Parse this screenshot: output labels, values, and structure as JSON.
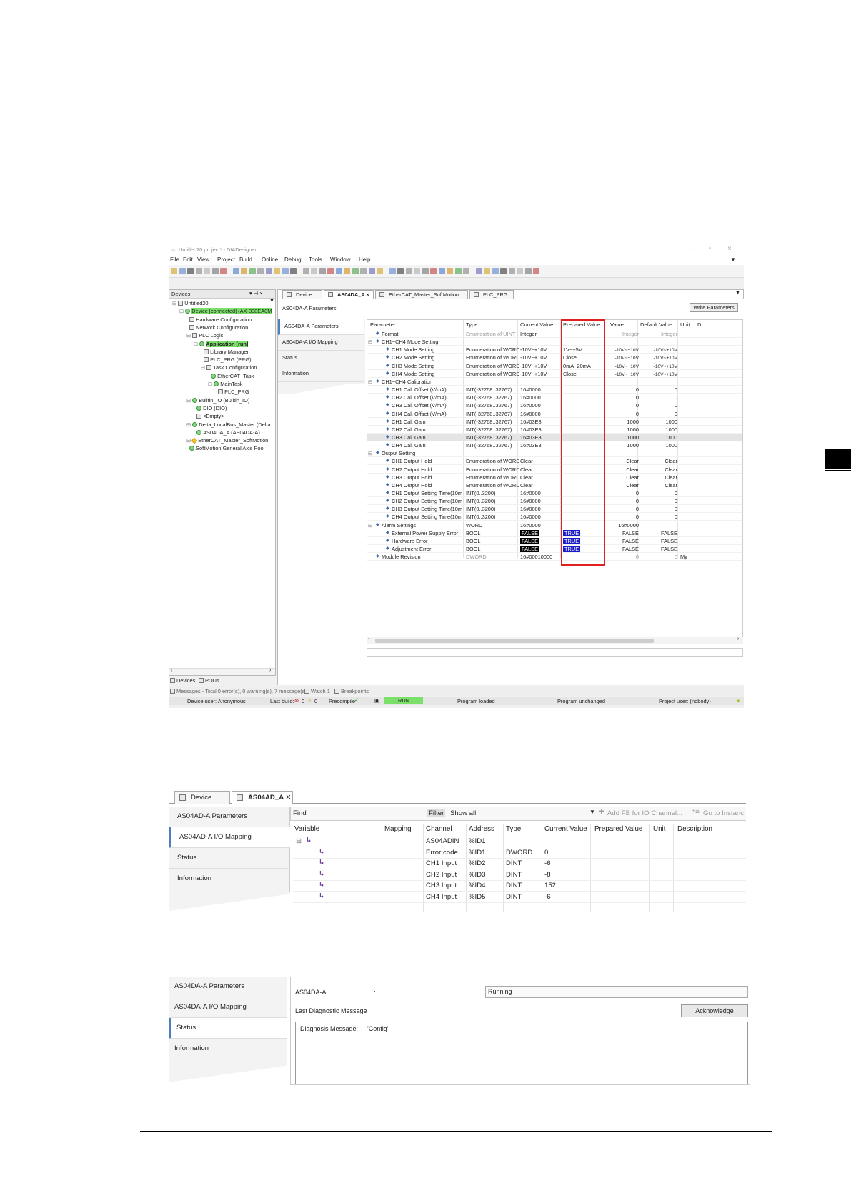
{
  "window": {
    "title": "Untitled20.project* - DIADesigner",
    "menu": [
      "File",
      "Edit",
      "View",
      "Project",
      "Build",
      "Online",
      "Debug",
      "Tools",
      "Window",
      "Help"
    ],
    "devices_panel": {
      "title": "Devices",
      "items": [
        {
          "label": "Untitled20",
          "indent": 0
        },
        {
          "label": "Device [connected] (AX-308EA0M",
          "indent": 1,
          "highlight": true
        },
        {
          "label": "Hardware Configuration",
          "indent": 2
        },
        {
          "label": "Network Configuration",
          "indent": 2
        },
        {
          "label": "PLC Logic",
          "indent": 2
        },
        {
          "label": "Application [run]",
          "indent": 3,
          "highlight": true,
          "bold": true
        },
        {
          "label": "Library Manager",
          "indent": 4
        },
        {
          "label": "PLC_PRG (PRG)",
          "indent": 4
        },
        {
          "label": "Task Configuration",
          "indent": 4
        },
        {
          "label": "EtherCAT_Task",
          "indent": 5
        },
        {
          "label": "MainTask",
          "indent": 5
        },
        {
          "label": "PLC_PRG",
          "indent": 6
        },
        {
          "label": "Builtin_IO (Builtin_IO)",
          "indent": 2
        },
        {
          "label": "DIO (DIO)",
          "indent": 3
        },
        {
          "label": "<Empty>",
          "indent": 3
        },
        {
          "label": "Delta_LocalBus_Master (Delta",
          "indent": 2
        },
        {
          "label": "AS04DA_A (AS04DA-A)",
          "indent": 3
        },
        {
          "label": "EtherCAT_Master_SoftMotion",
          "indent": 2
        },
        {
          "label": "SoftMotion General Axis Pool",
          "indent": 2
        }
      ],
      "bottom_tabs": [
        "Devices",
        "POUs"
      ]
    },
    "tabs": [
      "Device",
      "AS04DA_A",
      "EtherCAT_Master_SoftMotion",
      "PLC_PRG"
    ],
    "nav": [
      "AS04DA-A Parameters",
      "AS04DA-A I/O Mapping",
      "Status",
      "Information"
    ],
    "header_label": "AS04DA-A Parameters",
    "write_button": "Write Parameters",
    "columns": [
      "Parameter",
      "Type",
      "Current Value",
      "Prepared Value",
      "Value",
      "Default Value",
      "Unit",
      "D"
    ],
    "rows": [
      {
        "lvl": 1,
        "p": "Format",
        "t": "Enumeration of UINT",
        "cv": "Integer",
        "pv": "",
        "v": "Integer",
        "dv": "Integer",
        "u": "",
        "gray": true
      },
      {
        "lvl": 1,
        "p": "CH1~CH4 Mode Setting",
        "group": true
      },
      {
        "lvl": 2,
        "p": "CH1 Mode Setting",
        "t": "Enumeration of WORD",
        "cv": "-10V~+10V",
        "pv": "1V~+5V",
        "v": "-10V~+10V",
        "dv": "-10V~+10V"
      },
      {
        "lvl": 2,
        "p": "CH2 Mode Setting",
        "t": "Enumeration of WORD",
        "cv": "-10V~+10V",
        "pv": "Close",
        "v": "-10V~+10V",
        "dv": "-10V~+10V"
      },
      {
        "lvl": 2,
        "p": "CH3 Mode Setting",
        "t": "Enumeration of WORD",
        "cv": "-10V~+10V",
        "pv": "0mA~20mA",
        "v": "-10V~+10V",
        "dv": "-10V~+10V"
      },
      {
        "lvl": 2,
        "p": "CH4 Mode Setting",
        "t": "Enumeration of WORD",
        "cv": "-10V~+10V",
        "pv": "Close",
        "v": "-10V~+10V",
        "dv": "-10V~+10V"
      },
      {
        "lvl": 1,
        "p": "CH1~CH4 Calibration",
        "group": true
      },
      {
        "lvl": 2,
        "p": "CH1 Cal. Offset (V/mA)",
        "t": "INT(-32768..32767)",
        "cv": "16#0000",
        "pv": "",
        "v": "0",
        "dv": "0"
      },
      {
        "lvl": 2,
        "p": "CH2 Cal. Offset (V/mA)",
        "t": "INT(-32768..32767)",
        "cv": "16#0000",
        "pv": "",
        "v": "0",
        "dv": "0"
      },
      {
        "lvl": 2,
        "p": "CH3 Cal. Offset (V/mA)",
        "t": "INT(-32768..32767)",
        "cv": "16#0000",
        "pv": "",
        "v": "0",
        "dv": "0"
      },
      {
        "lvl": 2,
        "p": "CH4 Cal. Offset (V/mA)",
        "t": "INT(-32768..32767)",
        "cv": "16#0000",
        "pv": "",
        "v": "0",
        "dv": "0"
      },
      {
        "lvl": 2,
        "p": "CH1 Cal. Gain",
        "t": "INT(-32768..32767)",
        "cv": "16#03E8",
        "pv": "",
        "v": "1000",
        "dv": "1000"
      },
      {
        "lvl": 2,
        "p": "CH2 Cal. Gain",
        "t": "INT(-32768..32767)",
        "cv": "16#03E8",
        "pv": "",
        "v": "1000",
        "dv": "1000"
      },
      {
        "lvl": 2,
        "p": "CH3 Cal. Gain",
        "t": "INT(-32768..32767)",
        "cv": "16#03E8",
        "pv": "",
        "v": "1000",
        "dv": "1000",
        "sel": true
      },
      {
        "lvl": 2,
        "p": "CH4 Cal. Gain",
        "t": "INT(-32768..32767)",
        "cv": "16#03E8",
        "pv": "",
        "v": "1000",
        "dv": "1000"
      },
      {
        "lvl": 1,
        "p": "Output Setting",
        "group": true
      },
      {
        "lvl": 2,
        "p": "CH1 Output Hold",
        "t": "Enumeration of WORD",
        "cv": "Clear",
        "pv": "",
        "v": "Clear",
        "dv": "Clear"
      },
      {
        "lvl": 2,
        "p": "CH2 Output Hold",
        "t": "Enumeration of WORD",
        "cv": "Clear",
        "pv": "",
        "v": "Clear",
        "dv": "Clear"
      },
      {
        "lvl": 2,
        "p": "CH3 Output Hold",
        "t": "Enumeration of WORD",
        "cv": "Clear",
        "pv": "",
        "v": "Clear",
        "dv": "Clear"
      },
      {
        "lvl": 2,
        "p": "CH4 Output Hold",
        "t": "Enumeration of WORD",
        "cv": "Clear",
        "pv": "",
        "v": "Clear",
        "dv": "Clear"
      },
      {
        "lvl": 2,
        "p": "CH1 Output Setting Time(10ms)",
        "t": "INT(0..3200)",
        "cv": "16#0000",
        "pv": "",
        "v": "0",
        "dv": "0"
      },
      {
        "lvl": 2,
        "p": "CH2 Output Setting Time(10ms)",
        "t": "INT(0..3200)",
        "cv": "16#0000",
        "pv": "",
        "v": "0",
        "dv": "0"
      },
      {
        "lvl": 2,
        "p": "CH3 Output Setting Time(10ms)",
        "t": "INT(0..3200)",
        "cv": "16#0000",
        "pv": "",
        "v": "0",
        "dv": "0"
      },
      {
        "lvl": 2,
        "p": "CH4 Output Setting Time(10ms)",
        "t": "INT(0..3200)",
        "cv": "16#0000",
        "pv": "",
        "v": "0",
        "dv": "0"
      },
      {
        "lvl": 1,
        "p": "Alarm Settings",
        "t": "WORD",
        "cv": "16#0000",
        "pv": "",
        "v": "16#0000",
        "dv": "",
        "grouptyped": true
      },
      {
        "lvl": 2,
        "p": "External Power Supply Error",
        "t": "BOOL",
        "cv": "FALSE",
        "pv": "TRUE",
        "v": "FALSE",
        "dv": "FALSE",
        "bool": true
      },
      {
        "lvl": 2,
        "p": "Hardware Error",
        "t": "BOOL",
        "cv": "FALSE",
        "pv": "TRUE",
        "v": "FALSE",
        "dv": "FALSE",
        "bool": true
      },
      {
        "lvl": 2,
        "p": "Adjustment Error",
        "t": "BOOL",
        "cv": "FALSE",
        "pv": "TRUE",
        "v": "FALSE",
        "dv": "FALSE",
        "bool": true
      },
      {
        "lvl": 1,
        "p": "Module Revision",
        "t": "DWORD",
        "cv": "16#00010000",
        "pv": "",
        "v": "0",
        "dv": "0",
        "u": "My",
        "gray": true
      }
    ],
    "messages_bar": [
      "Messages - Total 0 error(s), 0 warning(s), 7 message(s)",
      "Watch 1",
      "Breakpoints"
    ],
    "status_bar": {
      "device_user": "Device user: Anonymous",
      "last_build": "Last build:",
      "errors": "0",
      "warnings": "0",
      "precompile": "Precompile",
      "run": "RUN",
      "program_loaded": "Program loaded",
      "program_unchanged": "Program unchanged",
      "project_user": "Project user: (nobody)"
    }
  },
  "iomap": {
    "tabs": [
      "Device",
      "AS04AD_A"
    ],
    "nav": [
      "AS04AD-A Parameters",
      "AS04AD-A I/O Mapping",
      "Status",
      "Information"
    ],
    "find_label": "Find",
    "filter_label": "Filter",
    "filter_value": "Show all",
    "add_fb": "Add FB for IO Channel...",
    "goto": "Go to Instanc",
    "columns": [
      "Variable",
      "Mapping",
      "Channel",
      "Address",
      "Type",
      "Current Value",
      "Prepared Value",
      "Unit",
      "Description"
    ],
    "rows": [
      {
        "ch": "AS04ADIN",
        "addr": "%ID1",
        "type": "",
        "cv": ""
      },
      {
        "ch": "Error code",
        "addr": "%ID1",
        "type": "DWORD",
        "cv": "0"
      },
      {
        "ch": "CH1 Input",
        "addr": "%ID2",
        "type": "DINT",
        "cv": "-6"
      },
      {
        "ch": "CH2 Input",
        "addr": "%ID3",
        "type": "DINT",
        "cv": "-8"
      },
      {
        "ch": "CH3 Input",
        "addr": "%ID4",
        "type": "DINT",
        "cv": "152"
      },
      {
        "ch": "CH4 Input",
        "addr": "%ID5",
        "type": "DINT",
        "cv": "-6"
      }
    ]
  },
  "statusshot": {
    "nav": [
      "AS04DA-A Parameters",
      "AS04DA-A I/O Mapping",
      "Status",
      "Information"
    ],
    "module": "AS04DA-A",
    "colon": ":",
    "state": "Running",
    "last_diag": "Last Diagnostic Message",
    "ack": "Acknowledge",
    "diag_label": "Diagnosis Message:",
    "diag_value": "'Config'"
  }
}
